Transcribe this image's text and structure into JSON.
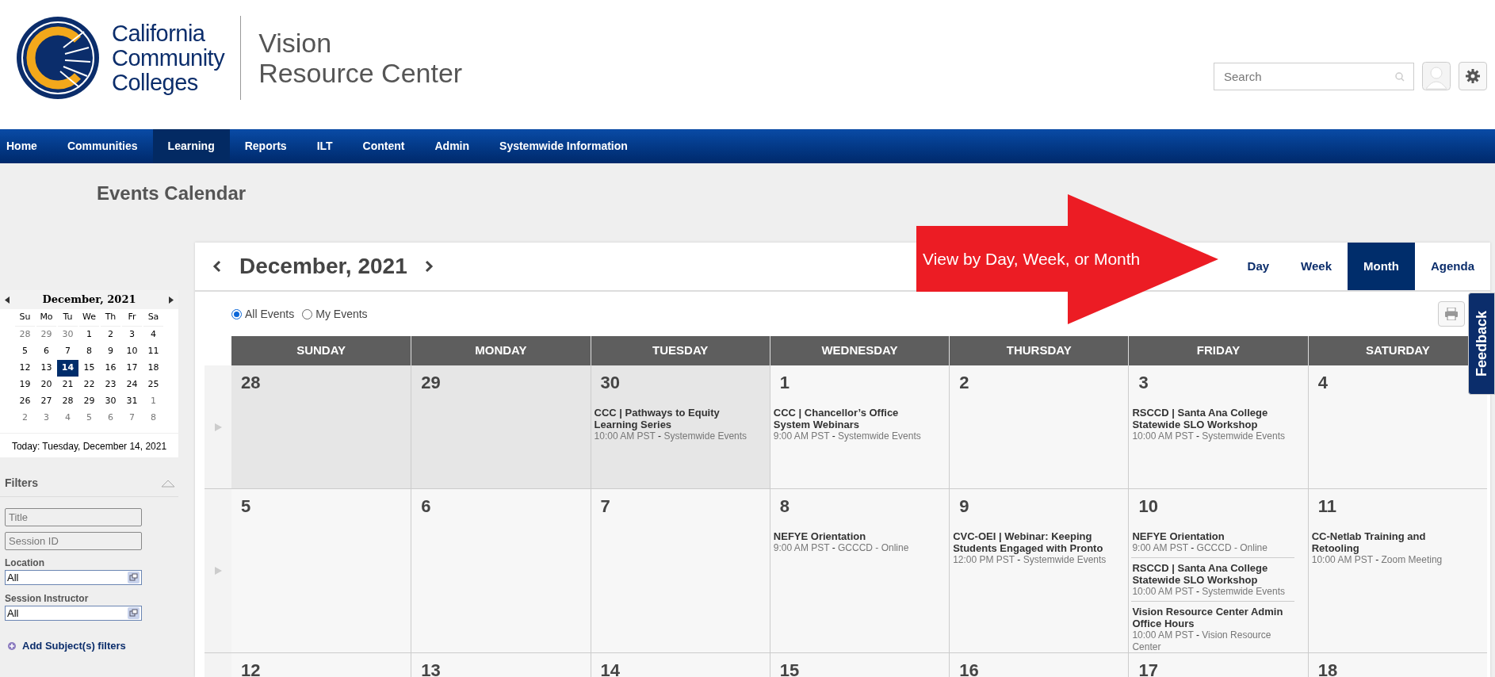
{
  "header": {
    "logo_lines": [
      "California",
      "Community",
      "Colleges"
    ],
    "site_title_lines": [
      "Vision",
      "Resource Center"
    ],
    "search": {
      "placeholder": "Search"
    }
  },
  "nav": [
    {
      "label": "Home",
      "selected": false
    },
    {
      "label": "Communities",
      "selected": false
    },
    {
      "label": "Learning",
      "selected": true
    },
    {
      "label": "Reports",
      "selected": false
    },
    {
      "label": "ILT",
      "selected": false
    },
    {
      "label": "Content",
      "selected": false
    },
    {
      "label": "Admin",
      "selected": false
    },
    {
      "label": "Systemwide Information",
      "selected": false
    }
  ],
  "page_title": "Events Calendar",
  "mini_calendar": {
    "title": "December, 2021",
    "weekdays": [
      "Su",
      "Mo",
      "Tu",
      "We",
      "Th",
      "Fr",
      "Sa"
    ],
    "weeks": [
      [
        {
          "day": "28",
          "other_month": true,
          "selected": false
        },
        {
          "day": "29",
          "other_month": true,
          "selected": false
        },
        {
          "day": "30",
          "other_month": true,
          "selected": false
        },
        {
          "day": "1",
          "other_month": false,
          "selected": false
        },
        {
          "day": "2",
          "other_month": false,
          "selected": false
        },
        {
          "day": "3",
          "other_month": false,
          "selected": false
        },
        {
          "day": "4",
          "other_month": false,
          "selected": false
        }
      ],
      [
        {
          "day": "5",
          "other_month": false,
          "selected": false
        },
        {
          "day": "6",
          "other_month": false,
          "selected": false
        },
        {
          "day": "7",
          "other_month": false,
          "selected": false
        },
        {
          "day": "8",
          "other_month": false,
          "selected": false
        },
        {
          "day": "9",
          "other_month": false,
          "selected": false
        },
        {
          "day": "10",
          "other_month": false,
          "selected": false
        },
        {
          "day": "11",
          "other_month": false,
          "selected": false
        }
      ],
      [
        {
          "day": "12",
          "other_month": false,
          "selected": false
        },
        {
          "day": "13",
          "other_month": false,
          "selected": false
        },
        {
          "day": "14",
          "other_month": false,
          "selected": true
        },
        {
          "day": "15",
          "other_month": false,
          "selected": false
        },
        {
          "day": "16",
          "other_month": false,
          "selected": false
        },
        {
          "day": "17",
          "other_month": false,
          "selected": false
        },
        {
          "day": "18",
          "other_month": false,
          "selected": false
        }
      ],
      [
        {
          "day": "19",
          "other_month": false,
          "selected": false
        },
        {
          "day": "20",
          "other_month": false,
          "selected": false
        },
        {
          "day": "21",
          "other_month": false,
          "selected": false
        },
        {
          "day": "22",
          "other_month": false,
          "selected": false
        },
        {
          "day": "23",
          "other_month": false,
          "selected": false
        },
        {
          "day": "24",
          "other_month": false,
          "selected": false
        },
        {
          "day": "25",
          "other_month": false,
          "selected": false
        }
      ],
      [
        {
          "day": "26",
          "other_month": false,
          "selected": false
        },
        {
          "day": "27",
          "other_month": false,
          "selected": false
        },
        {
          "day": "28",
          "other_month": false,
          "selected": false
        },
        {
          "day": "29",
          "other_month": false,
          "selected": false
        },
        {
          "day": "30",
          "other_month": false,
          "selected": false
        },
        {
          "day": "31",
          "other_month": false,
          "selected": false
        },
        {
          "day": "1",
          "other_month": true,
          "selected": false
        }
      ],
      [
        {
          "day": "2",
          "other_month": true,
          "selected": false
        },
        {
          "day": "3",
          "other_month": true,
          "selected": false
        },
        {
          "day": "4",
          "other_month": true,
          "selected": false
        },
        {
          "day": "5",
          "other_month": true,
          "selected": false
        },
        {
          "day": "6",
          "other_month": true,
          "selected": false
        },
        {
          "day": "7",
          "other_month": true,
          "selected": false
        },
        {
          "day": "8",
          "other_month": true,
          "selected": false
        }
      ]
    ],
    "today": "Today: Tuesday, December 14, 2021"
  },
  "filters": {
    "title": "Filters",
    "expanded": true,
    "fields": [
      {
        "kind": "text",
        "placeholder": "Title"
      },
      {
        "kind": "text",
        "placeholder": "Session ID"
      },
      {
        "kind": "lookup",
        "label": "Location",
        "value": "All"
      },
      {
        "kind": "lookup",
        "label": "Session Instructor",
        "value": "All"
      }
    ],
    "add_link": "Add Subject(s) filters"
  },
  "calendar": {
    "title": "December, 2021",
    "views": [
      {
        "label": "Day",
        "selected": false
      },
      {
        "label": "Week",
        "selected": false
      },
      {
        "label": "Month",
        "selected": true
      },
      {
        "label": "Agenda",
        "selected": false
      }
    ],
    "event_filter": [
      {
        "label": "All Events",
        "selected": true
      },
      {
        "label": "My Events",
        "selected": false
      }
    ],
    "weekdays": [
      "SUNDAY",
      "MONDAY",
      "TUESDAY",
      "WEDNESDAY",
      "THURSDAY",
      "FRIDAY",
      "SATURDAY"
    ],
    "weeks": [
      [
        {
          "day": "28",
          "other_month": true
        },
        {
          "day": "29",
          "other_month": true
        },
        {
          "day": "30",
          "other_month": true,
          "events": [
            {
              "title": "CCC | Pathways to Equity Learning Series",
              "time": "10:00 AM PST",
              "location": "Systemwide Events"
            }
          ]
        },
        {
          "day": "1",
          "other_month": false,
          "events": [
            {
              "title": "CCC | Chancellor’s Office System Webinars",
              "time": "9:00 AM PST",
              "location": "Systemwide Events"
            }
          ]
        },
        {
          "day": "2",
          "other_month": false
        },
        {
          "day": "3",
          "other_month": false,
          "events": [
            {
              "title": "RSCCD | Santa Ana College Statewide SLO Workshop",
              "time": "10:00 AM PST",
              "location": "Systemwide Events"
            }
          ]
        },
        {
          "day": "4",
          "other_month": false
        }
      ],
      [
        {
          "day": "5",
          "other_month": false
        },
        {
          "day": "6",
          "other_month": false
        },
        {
          "day": "7",
          "other_month": false
        },
        {
          "day": "8",
          "other_month": false,
          "events": [
            {
              "title": "NEFYE Orientation",
              "time": "9:00 AM PST",
              "location": "GCCCD - Online"
            }
          ]
        },
        {
          "day": "9",
          "other_month": false,
          "events": [
            {
              "title": "CVC-OEI | Webinar: Keeping Students Engaged with Pronto",
              "time": "12:00 PM PST",
              "location": "Systemwide Events"
            }
          ]
        },
        {
          "day": "10",
          "other_month": false,
          "events": [
            {
              "title": "NEFYE Orientation",
              "time": "9:00 AM PST",
              "location": "GCCCD - Online"
            },
            {
              "title": "RSCCD | Santa Ana College Statewide SLO Workshop",
              "time": "10:00 AM PST",
              "location": "Systemwide Events"
            },
            {
              "title": "Vision Resource Center Admin Office Hours",
              "time": "10:00 AM PST",
              "location": "Vision Resource Center"
            }
          ]
        },
        {
          "day": "11",
          "other_month": false,
          "events": [
            {
              "title": "CC-Netlab Training and Retooling",
              "time": "10:00 AM PST",
              "location": "Zoom Meeting"
            }
          ]
        }
      ],
      [
        {
          "day": "12",
          "other_month": false
        },
        {
          "day": "13",
          "other_month": false
        },
        {
          "day": "14",
          "other_month": false
        },
        {
          "day": "15",
          "other_month": false
        },
        {
          "day": "16",
          "other_month": false
        },
        {
          "day": "17",
          "other_month": false
        },
        {
          "day": "18",
          "other_month": false
        }
      ]
    ],
    "separator": "-"
  },
  "annotation": {
    "text": "View by Day, Week, or Month"
  },
  "feedback_tab": "Feedback"
}
